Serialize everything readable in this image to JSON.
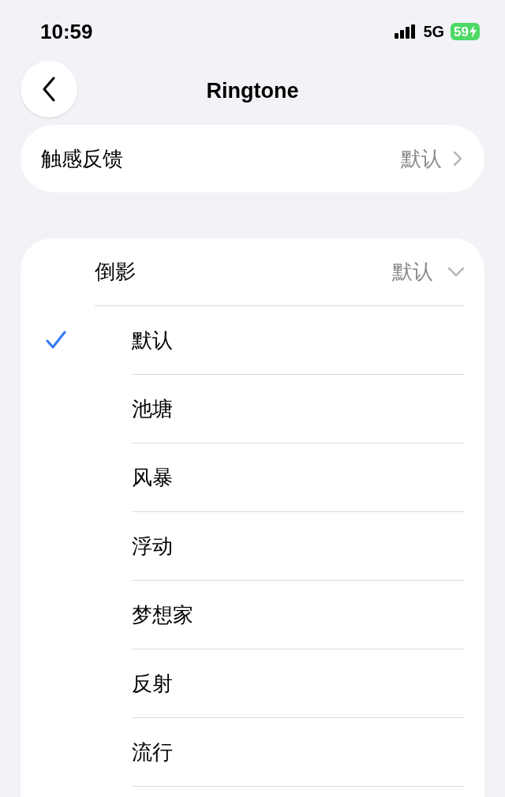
{
  "status_bar": {
    "time": "10:59",
    "network": "5G",
    "battery": "59",
    "charging": true
  },
  "nav": {
    "title": "Ringtone"
  },
  "haptics": {
    "label": "触感反馈",
    "value": "默认"
  },
  "section": {
    "title": "倒影",
    "value": "默认",
    "expanded": true
  },
  "tones": [
    {
      "label": "默认",
      "selected": true
    },
    {
      "label": "池塘",
      "selected": false
    },
    {
      "label": "风暴",
      "selected": false
    },
    {
      "label": "浮动",
      "selected": false
    },
    {
      "label": "梦想家",
      "selected": false
    },
    {
      "label": "反射",
      "selected": false
    },
    {
      "label": "流行",
      "selected": false
    }
  ]
}
